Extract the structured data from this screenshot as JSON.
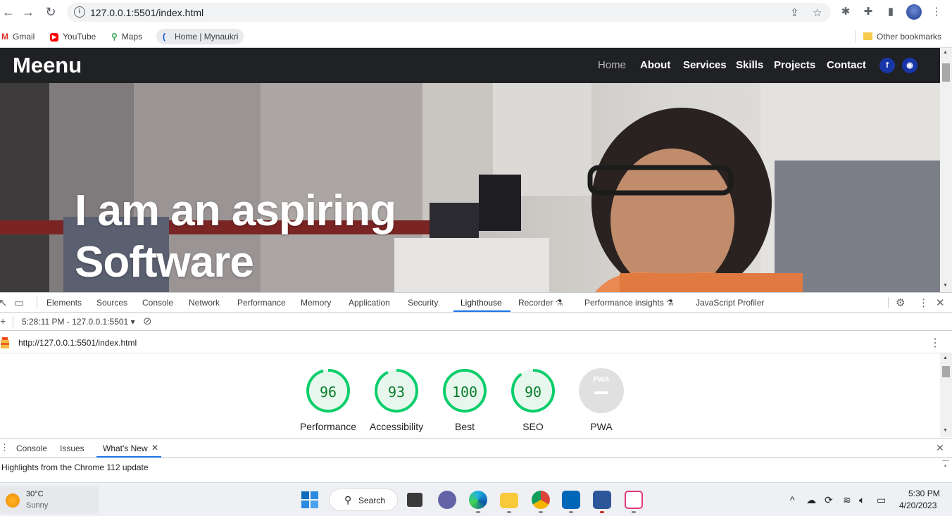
{
  "browser": {
    "url": "127.0.0.1:5501/index.html",
    "bookmarks": [
      {
        "label": "Gmail",
        "icon": "gmail-icon"
      },
      {
        "label": "YouTube",
        "icon": "youtube-icon"
      },
      {
        "label": "Maps",
        "icon": "maps-icon"
      },
      {
        "label": "Home | Mynaukri",
        "icon": "naukri-icon"
      }
    ],
    "other_bookmarks": "Other bookmarks"
  },
  "site": {
    "logo": "Meenu",
    "nav": [
      "Home",
      "About",
      "Services",
      "Skills",
      "Projects",
      "Contact"
    ],
    "hero_line1": "I am an aspiring",
    "hero_line2": "Software"
  },
  "devtools": {
    "tabs": [
      "Elements",
      "Sources",
      "Console",
      "Network",
      "Performance",
      "Memory",
      "Application",
      "Security",
      "Lighthouse",
      "Recorder",
      "Performance insights",
      "JavaScript Profiler"
    ],
    "active_tab": "Lighthouse",
    "report_selector": "5:28:11 PM - 127.0.0.1:5501",
    "report_url": "http://127.0.0.1:5501/index.html",
    "scores": [
      {
        "label": "Performance",
        "score": "96",
        "value": 96
      },
      {
        "label": "Accessibility",
        "score": "93",
        "value": 93
      },
      {
        "label": "Best",
        "score": "100",
        "value": 100
      },
      {
        "label": "SEO",
        "score": "90",
        "value": 90
      },
      {
        "label": "PWA",
        "score": "PWA",
        "value": null
      }
    ],
    "score_color": "#0cce6b",
    "drawer_tabs": [
      "Console",
      "Issues",
      "What's New"
    ],
    "drawer_active": "What's New",
    "drawer_text": "Highlights from the Chrome 112 update"
  },
  "taskbar": {
    "weather_temp": "30°C",
    "weather_desc": "Sunny",
    "search_label": "Search",
    "time": "5:30 PM",
    "date": "4/20/2023"
  }
}
